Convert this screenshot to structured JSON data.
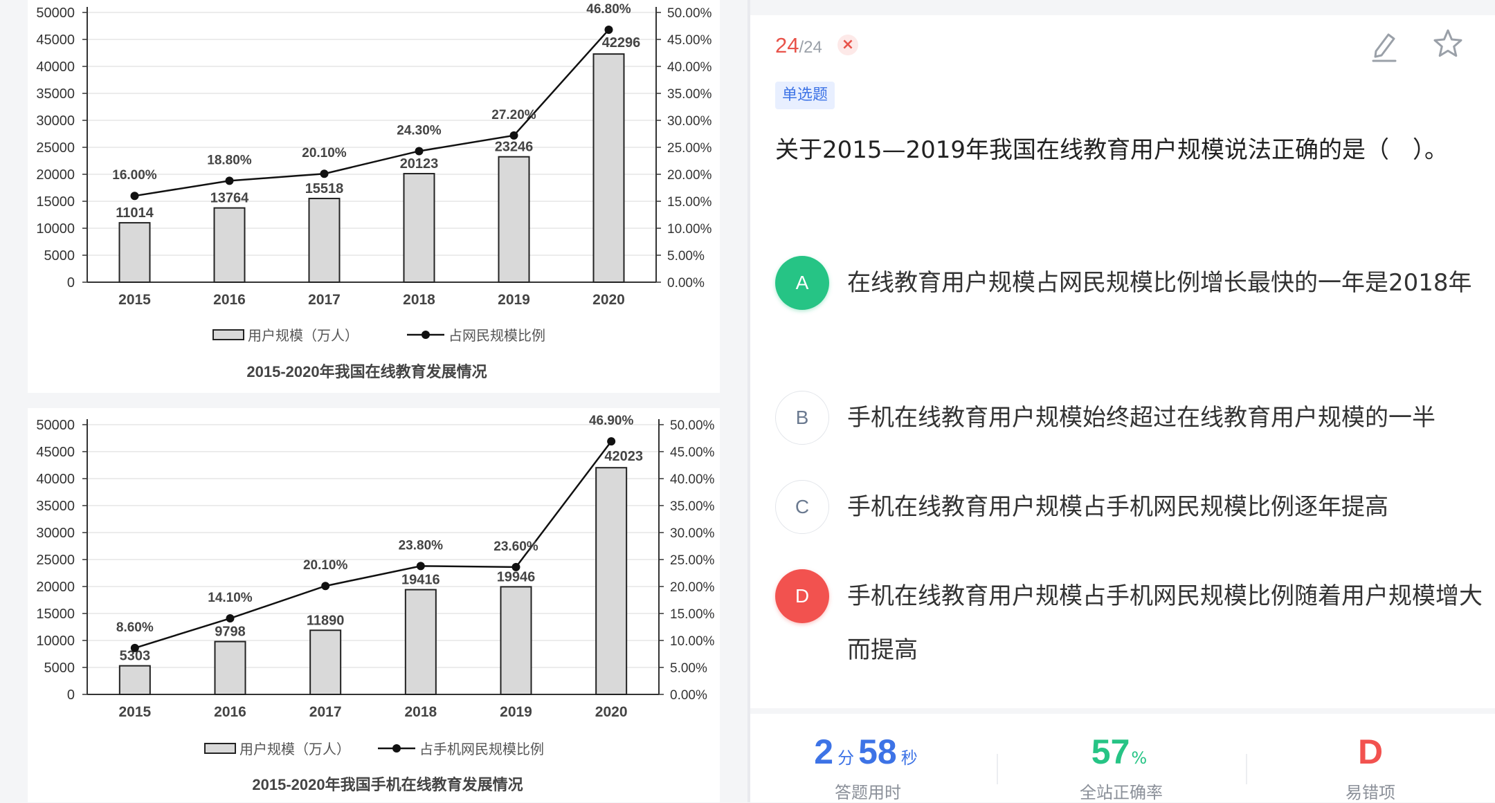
{
  "charts": [
    {
      "title": "2015-2020年我国在线教育发展情况",
      "legend_bar": "用户规模（万人）",
      "legend_line": "占网民规模比例",
      "left_ticks": [
        "50000",
        "45000",
        "40000",
        "35000",
        "30000",
        "25000",
        "20000",
        "15000",
        "10000",
        "5000",
        "0"
      ],
      "right_ticks": [
        "50.00%",
        "45.00%",
        "40.00%",
        "35.00%",
        "30.00%",
        "25.00%",
        "20.00%",
        "15.00%",
        "10.00%",
        "5.00%",
        "0.00%"
      ],
      "categories": [
        "2015",
        "2016",
        "2017",
        "2018",
        "2019",
        "2020"
      ],
      "bar_labels": [
        "11014",
        "13764",
        "15518",
        "20123",
        "23246",
        "42296"
      ],
      "line_labels": [
        "16.00%",
        "18.80%",
        "20.10%",
        "24.30%",
        "27.20%",
        "46.80%"
      ]
    },
    {
      "title": "2015-2020年我国手机在线教育发展情况",
      "legend_bar": "用户规模（万人）",
      "legend_line": "占手机网民规模比例",
      "left_ticks": [
        "50000",
        "45000",
        "40000",
        "35000",
        "30000",
        "25000",
        "20000",
        "15000",
        "10000",
        "5000",
        "0"
      ],
      "right_ticks": [
        "50.00%",
        "45.00%",
        "40.00%",
        "35.00%",
        "30.00%",
        "25.00%",
        "20.00%",
        "15.00%",
        "10.00%",
        "5.00%",
        "0.00%"
      ],
      "categories": [
        "2015",
        "2016",
        "2017",
        "2018",
        "2019",
        "2020"
      ],
      "bar_labels": [
        "5303",
        "9798",
        "11890",
        "19416",
        "19946",
        "42023"
      ],
      "line_labels": [
        "8.60%",
        "14.10%",
        "20.10%",
        "23.80%",
        "23.60%",
        "46.90%"
      ]
    }
  ],
  "chart_data": [
    {
      "type": "bar",
      "title": "2015-2020年我国在线教育发展情况",
      "categories": [
        "2015",
        "2016",
        "2017",
        "2018",
        "2019",
        "2020"
      ],
      "series": [
        {
          "name": "用户规模（万人）",
          "type": "bar",
          "axis": "left",
          "values": [
            11014,
            13764,
            15518,
            20123,
            23246,
            42296
          ]
        },
        {
          "name": "占网民规模比例",
          "type": "line",
          "axis": "right",
          "values": [
            16.0,
            18.8,
            20.1,
            24.3,
            27.2,
            46.8
          ]
        }
      ],
      "ylim": [
        0,
        50000
      ],
      "y2lim": [
        0,
        50
      ],
      "legend": "bottom"
    },
    {
      "type": "bar",
      "title": "2015-2020年我国手机在线教育发展情况",
      "categories": [
        "2015",
        "2016",
        "2017",
        "2018",
        "2019",
        "2020"
      ],
      "series": [
        {
          "name": "用户规模（万人）",
          "type": "bar",
          "axis": "left",
          "values": [
            5303,
            9798,
            11890,
            19416,
            19946,
            42023
          ]
        },
        {
          "name": "占手机网民规模比例",
          "type": "line",
          "axis": "right",
          "values": [
            8.6,
            14.1,
            20.1,
            23.8,
            23.6,
            46.9
          ]
        }
      ],
      "ylim": [
        0,
        50000
      ],
      "y2lim": [
        0,
        50
      ],
      "legend": "bottom"
    }
  ],
  "question": {
    "current": "24",
    "total": "/24",
    "wrong_mark": "×",
    "tag": "单选题",
    "stem": "关于2015—2019年我国在线教育用户规模说法正确的是（　）。",
    "options": [
      {
        "letter": "A",
        "text": "在线教育用户规模占网民规模比例增长最快的一年是2018年",
        "state": "correct"
      },
      {
        "letter": "B",
        "text": "手机在线教育用户规模始终超过在线教育用户规模的一半",
        "state": "neutral"
      },
      {
        "letter": "C",
        "text": "手机在线教育用户规模占手机网民规模比例逐年提高",
        "state": "neutral"
      },
      {
        "letter": "D",
        "text": "手机在线教育用户规模占手机网民规模比例随着用户规模增大而提高",
        "state": "selected-wrong"
      }
    ]
  },
  "stats": {
    "time_min": "2",
    "time_min_unit": "分",
    "time_sec": "58",
    "time_sec_unit": "秒",
    "time_label": "答题用时",
    "accuracy": "57",
    "accuracy_unit": "%",
    "accuracy_label": "全站正确率",
    "error_option": "D",
    "error_label": "易错项"
  },
  "colors": {
    "correct": "#26c485",
    "wrong": "#f2524f",
    "blue": "#3d73e6",
    "bar_fill": "#d9d9d9"
  },
  "icons": {
    "edit": "edit-icon",
    "star": "star-icon"
  }
}
